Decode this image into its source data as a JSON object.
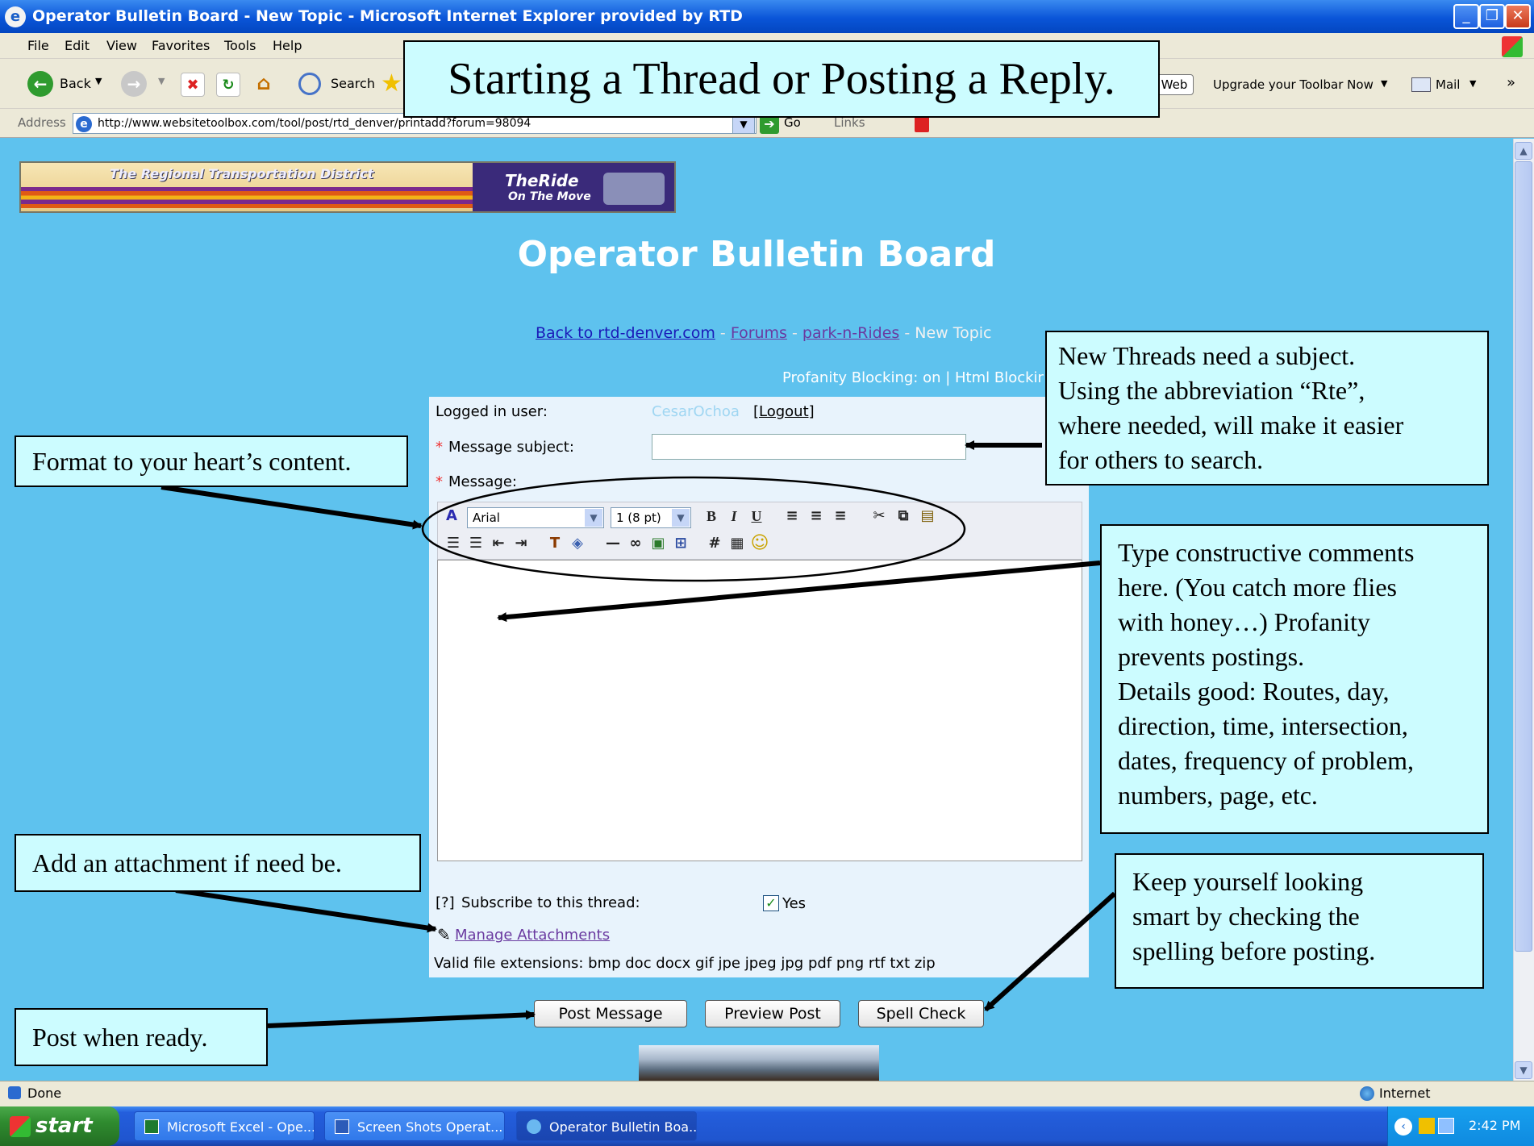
{
  "window": {
    "title": "Operator Bulletin Board - New Topic - Microsoft Internet Explorer provided by RTD",
    "min_glyph": "_",
    "max_glyph": "❐",
    "close_glyph": "✕"
  },
  "menu": [
    "File",
    "Edit",
    "View",
    "Favorites",
    "Tools",
    "Help"
  ],
  "toolbar": {
    "back_label": "Back",
    "search_label": "Search",
    "web_label": "Web",
    "upgrade_label": "Upgrade your Toolbar Now",
    "mail_label": "Mail",
    "more_glyph": "»"
  },
  "addressbar": {
    "label": "Address",
    "url": "http://www.websitetoolbox.com/tool/post/rtd_denver/printadd?forum=98094",
    "go_label": "Go",
    "links_label": "Links"
  },
  "banner": {
    "agency": "The Regional Transportation District",
    "brand": "TheRide",
    "tagline": "On The Move"
  },
  "page": {
    "title": "Operator Bulletin Board",
    "nav": {
      "back_link": "Back to rtd-denver.com",
      "sep": " - ",
      "forums_link": "Forums",
      "park_link": "park-n-Rides",
      "current": "New Topic"
    },
    "profanity": "Profanity Blocking: on | Html Blocking: on"
  },
  "form": {
    "logged_in_label": "Logged in user:",
    "username": "CesarOchoa",
    "logout": "[Logout]",
    "required_mark": "*",
    "subject_label": "Message subject:",
    "subject_value": "",
    "message_label": "Message:",
    "font_select": "Arial",
    "size_select": "1 (8 pt)",
    "subscribe_help": "[?]",
    "subscribe_label": "Subscribe to this thread:",
    "subscribe_yes": "Yes",
    "manage_attachments": "Manage Attachments",
    "valid_ext": "Valid file extensions: bmp doc docx gif jpe jpeg jpg pdf png rtf txt zip"
  },
  "buttons": {
    "post": "Post Message",
    "preview": "Preview Post",
    "spell": "Spell Check"
  },
  "statusbar": {
    "status": "Done",
    "zone": "Internet"
  },
  "taskbar": {
    "start": "start",
    "tasks": [
      "Microsoft Excel - Ope...",
      "Screen Shots Operat...",
      "Operator Bulletin Boa..."
    ],
    "clock": "2:42 PM"
  },
  "annotations": {
    "heading": "Starting a Thread or Posting a Reply.",
    "format": "Format to your heart’s content.",
    "subject": [
      "New Threads need a subject.",
      "Using the abbreviation “Rte”,",
      "where needed, will make it easier",
      "for others to search."
    ],
    "comments": [
      "Type constructive comments",
      "here.  (You catch more flies",
      "with honey…)  Profanity",
      "prevents postings.",
      "Details good: Routes, day,",
      "direction, time, intersection,",
      "dates, frequency of problem,",
      "numbers, page, etc."
    ],
    "attach": "Add an attachment if need be.",
    "spell": [
      "Keep yourself looking",
      "smart by checking the",
      "spelling before posting."
    ],
    "post": "Post when ready."
  }
}
